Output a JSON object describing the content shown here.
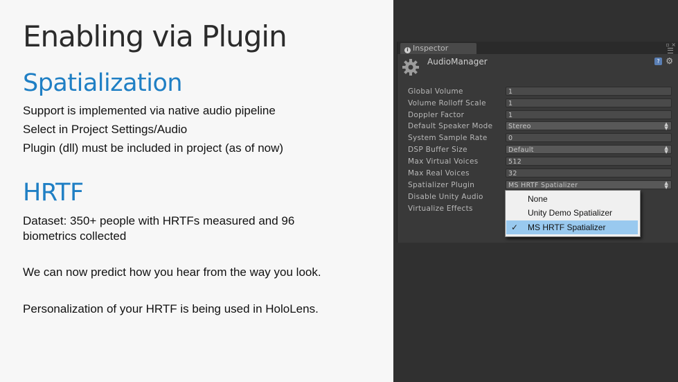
{
  "slide": {
    "title": "Enabling via Plugin",
    "section1": "Spatialization",
    "bullets1": [
      "Support is implemented via native audio pipeline",
      "Select in Project Settings/Audio",
      "Plugin (dll) must be included in project (as of now)"
    ],
    "section2": "HRTF",
    "bullets2": [
      "Dataset: 350+ people with HRTFs measured and 96",
      "biometrics collected",
      "We can now predict how you hear from the way you look.",
      "Personalization of your HRTF is being used in HoloLens."
    ]
  },
  "inspector": {
    "tab_label": "Inspector",
    "component_name": "AudioManager",
    "help_glyph": "?",
    "fields": [
      {
        "label": "Global Volume",
        "value": "1",
        "type": "text"
      },
      {
        "label": "Volume Rolloff Scale",
        "value": "1",
        "type": "text"
      },
      {
        "label": "Doppler Factor",
        "value": "1",
        "type": "text"
      },
      {
        "label": "Default Speaker Mode",
        "value": "Stereo",
        "type": "dropdown"
      },
      {
        "label": "System Sample Rate",
        "value": "0",
        "type": "text"
      },
      {
        "label": "DSP Buffer Size",
        "value": "Default",
        "type": "dropdown"
      },
      {
        "label": "Max Virtual Voices",
        "value": "512",
        "type": "text"
      },
      {
        "label": "Max Real Voices",
        "value": "32",
        "type": "text"
      },
      {
        "label": "Spatializer Plugin",
        "value": "MS HRTF Spatializer",
        "type": "dropdown"
      },
      {
        "label": "Disable Unity Audio",
        "value": "",
        "type": "none"
      },
      {
        "label": "Virtualize Effects",
        "value": "",
        "type": "none"
      }
    ]
  },
  "popup": {
    "options": [
      "None",
      "Unity Demo Spatializer",
      "MS HRTF Spatializer"
    ],
    "selected_index": 2,
    "check_glyph": "✓"
  },
  "colors": {
    "accent_blue": "#1f7fc4",
    "selection": "#99c9ef",
    "editor_bg": "#393939"
  }
}
